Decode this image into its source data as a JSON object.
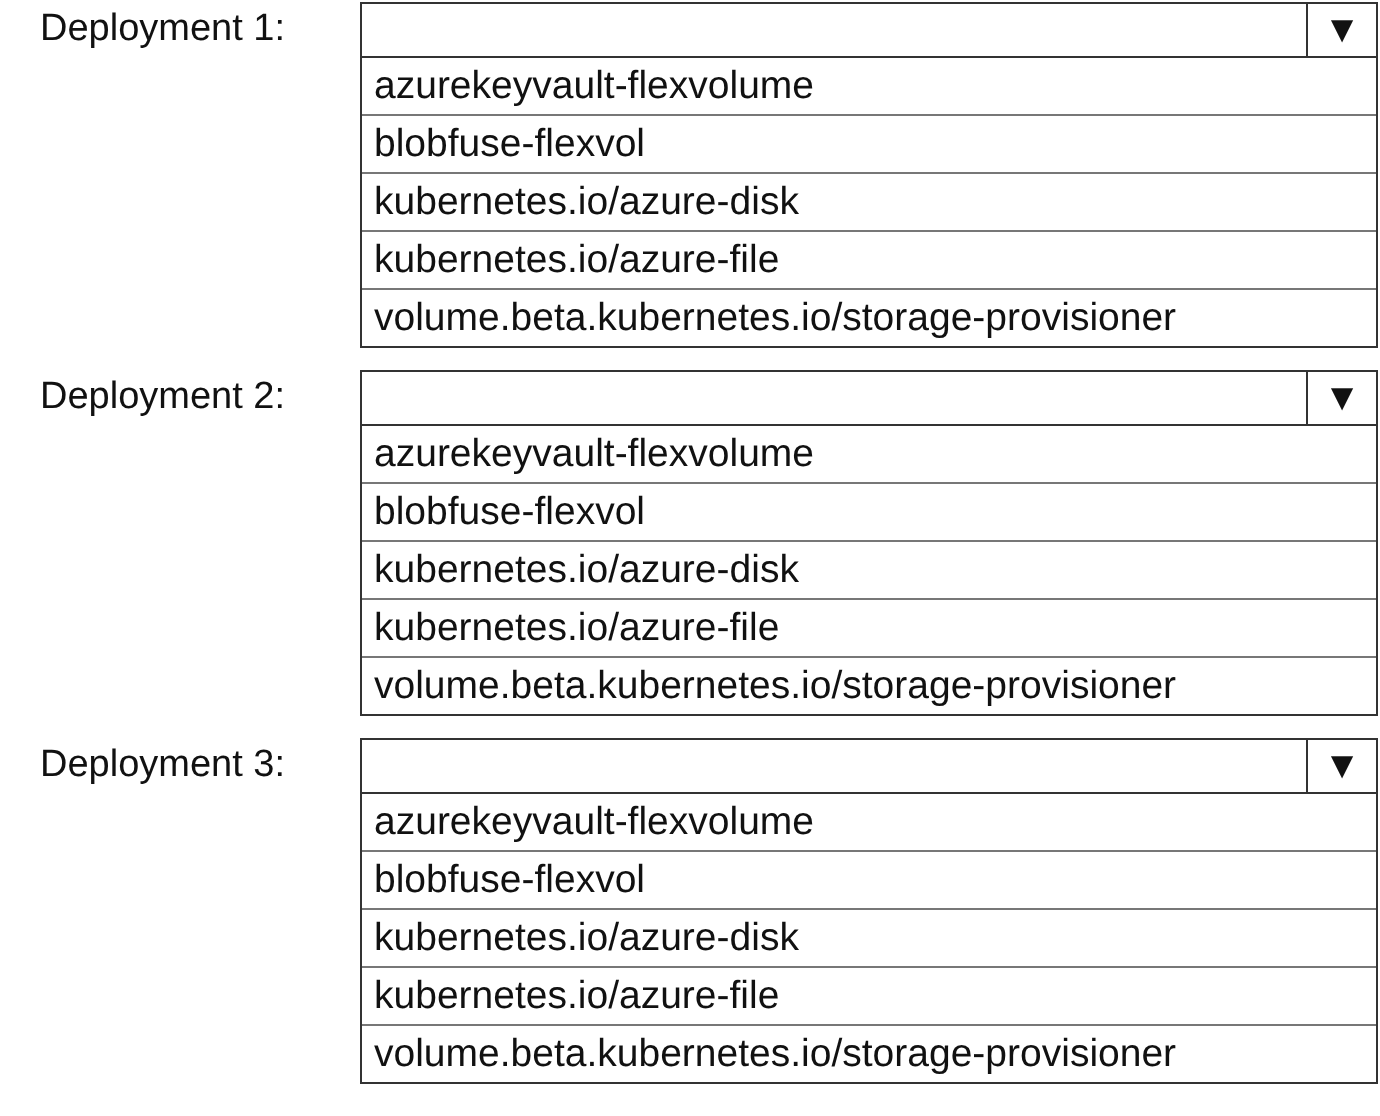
{
  "deployments": [
    {
      "label": "Deployment 1:",
      "arrow": "▼",
      "options": [
        "azurekeyvault-flexvolume",
        "blobfuse-flexvol",
        "kubernetes.io/azure-disk",
        "kubernetes.io/azure-file",
        "volume.beta.kubernetes.io/storage-provisioner"
      ]
    },
    {
      "label": "Deployment 2:",
      "arrow": "▼",
      "options": [
        "azurekeyvault-flexvolume",
        "blobfuse-flexvol",
        "kubernetes.io/azure-disk",
        "kubernetes.io/azure-file",
        "volume.beta.kubernetes.io/storage-provisioner"
      ]
    },
    {
      "label": "Deployment 3:",
      "arrow": "▼",
      "options": [
        "azurekeyvault-flexvolume",
        "blobfuse-flexvol",
        "kubernetes.io/azure-disk",
        "kubernetes.io/azure-file",
        "volume.beta.kubernetes.io/storage-provisioner"
      ]
    }
  ]
}
